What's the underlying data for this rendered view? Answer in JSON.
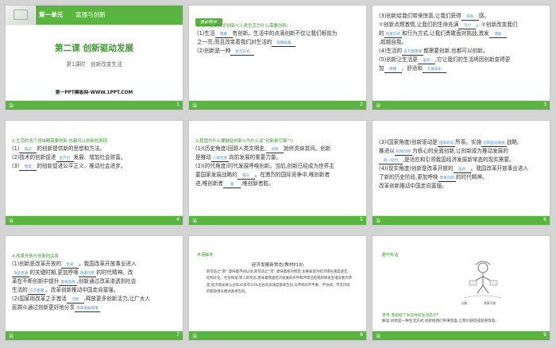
{
  "slide1": {
    "unit": "第一单元",
    "unit_title": "富强与创新",
    "title": "第二课 创新驱动发展",
    "subtitle": "第1课时　创新改变生活",
    "website": "第一PPT模板网-WWW.1PPT.COM",
    "page": "1"
  },
  "slide2": {
    "tag": "课前预学",
    "q1": "1.怎样正确认识创新?(人类生活为什么需要创新)",
    "l1a": "(1)生活",
    "b1": "需要",
    "l1b": "有创新。生活中的点滴创新不仅让我们眼前为",
    "l2": "之一亮,而且改变着我们对生活的",
    "b2": "观察视角",
    "l3a": "(2)创新是一种",
    "b3": "生活方式",
    "page": "2"
  },
  "slide3": {
    "l1a": "(3)创新给我们带来惊喜,让我们获得",
    "b1": "成就",
    "l1b": "感。",
    "l2a": "①创新点燃激情,让我们的生命充满",
    "b2": "活力",
    "l2b": "。②创新改变我们",
    "l3a": "的",
    "b3": "思维方式",
    "l3b": "和行为方式,让我们勇敢面对挑战,激发",
    "b4": "潜能",
    "l4": ",超越自我。",
    "l5a": "(4)生活的",
    "b5": "多方面需要",
    "l5b": "都需要创新,也都可以创新。",
    "l6a": "(5)创新让生活更",
    "b6": "美好",
    "l6b": ",它让我们的生活将因创新变得更",
    "l7a": "加",
    "b7": "便捷",
    "l7b": "、舒适和",
    "b8": "丰富多彩",
    "page": "3"
  },
  "slide4": {
    "q": "2.生活的各个领域都需要创新,也都可以创新的表现",
    "l1a": "(1)",
    "b1": "知识",
    "l1b": "的创新提供新的思想和方法。",
    "l2a": "(2)技术的创新促进",
    "b2": "生产力",
    "l2b": "发展、增加社会财富。",
    "l3a": "(3)",
    "b3": "制度",
    "l3b": "的创新促进公平正义、推动社会进步。",
    "page": "4"
  },
  "slide5": {
    "q": "3.我国为什么要鼓励创新?(为什么说“创新是引擎”?)",
    "l1a": "(1)(历史角度)回顾人类文明史,",
    "b1": "创新",
    "l1b": "始终贯穿其间。创新",
    "l2a": "是推动",
    "b2": "人类社会",
    "l2b": "向前发展的重要力量。",
    "l3": "(2)(时代角度)时代发展呼唤创新。当前,创新已经成为世界主",
    "l4a": "要国家发展战略的",
    "b4": "核心",
    "l4b": "。在激烈的国际竞争中,唯创新者",
    "l5a": "进,唯创新者",
    "b5": "强",
    "l5b": ",唯创新者胜。",
    "page": "5"
  },
  "slide6": {
    "l1a": "(3)(国家角度)创新驱动是",
    "b1": "国家命运",
    "l1b": "所系。实施",
    "b1b": "创新驱动发展",
    "l1c": "战略,",
    "l2a": "推进以",
    "b2": "科技创新",
    "l2b": "为核心的全面创新,让创新成为推动发展的",
    "b3": "第一动力",
    "l3b": ",是适应和引领我国经济发展新常态的现实需要。",
    "l4a": "(4)(现实角度)创新是改革开放的",
    "b4": "生命",
    "l4b": "。我国改革开放事业进入",
    "l5a": "了新的历史阶段,更加呼唤",
    "b5": "改革创新",
    "l5b": "的时代精神。",
    "l6": "改革创新推动中国走向富强。",
    "page": "6"
  },
  "slide7": {
    "q": "4.改革开放与创新的关系",
    "l1a": "(1)创新是改革开放的",
    "b1": "生命",
    "l1b": "。我国改革开放事业进入",
    "l2a": "",
    "b2": "攻坚克难",
    "l2b": "的关键时期,更加呼唤",
    "b3": "改革创新",
    "l2c": "的时代精神。改",
    "l3a": "革在不断创新中提升",
    "b4": "发展品质",
    "l3b": ",创新通过改革渗透到社会",
    "l4a": "生活的",
    "b5": "方方面面",
    "l4b": "。改革创新推动中国走向富强。",
    "l5": "(2)国家用改革之手激活",
    "b6": "创新",
    "l5b": ",释放更多创新活力,让广大人",
    "l6a": "民群众通过创新更好地分享",
    "b7": "改革发展成果",
    "page": "7"
  },
  "slide8": {
    "tag": "术语解读",
    "title": "经济发展新常态(教材P18)",
    "p1": "新常态之“新”,意味着不同以往;新常态之“常”,意味着相对稳定,主要表现为经济增长速度适宜、结构优化、社会和谐;转入新常态,意味着我国经济发展的条件和环境已经或即将发生诸多重大转变,经济增长将与过去30多年10%左右的高速度基本告别,与传统的不平衡、不协调、不可持续的粗放增长模式基本告别。",
    "page": "8"
  },
  "slide9": {
    "tag": "趣中有话",
    "cap1": "创新",
    "cap2": "改革开放",
    "q": "思考:漫画给了你怎样的生活启示?",
    "a": "解读:创新是一种生活方式;创新给我们带来惊喜,让我们获得成就感等等。",
    "page": "9"
  },
  "footer_mark": "治",
  "colors": {
    "green": "#5ab540",
    "dark_green": "#3c9a2e",
    "blank_text": "#4a8fd6"
  }
}
